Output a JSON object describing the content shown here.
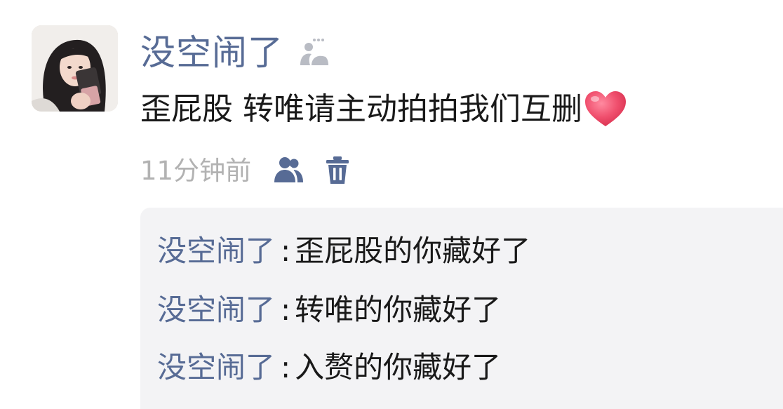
{
  "post": {
    "author": "没空闹了",
    "content": "歪屁股 转唯请主动拍拍我们互删",
    "content_emoji": "red-heart",
    "timestamp": "11分钟前"
  },
  "icons": {
    "friend": "friend-visibility-icon",
    "privacy": "people-icon",
    "delete": "trash-icon"
  },
  "comments": [
    {
      "name": "没空闹了",
      "separator": ":",
      "text": "歪屁股的你藏好了"
    },
    {
      "name": "没空闹了",
      "separator": ":",
      "text": "转唯的你藏好了"
    },
    {
      "name": "没空闹了",
      "separator": ":",
      "text": "入赘的你藏好了"
    }
  ],
  "colors": {
    "name_link": "#576b95",
    "text": "#191919",
    "timestamp": "#b2b2b2",
    "comment_bg": "#f3f3f5",
    "heart": "#f0506e"
  }
}
